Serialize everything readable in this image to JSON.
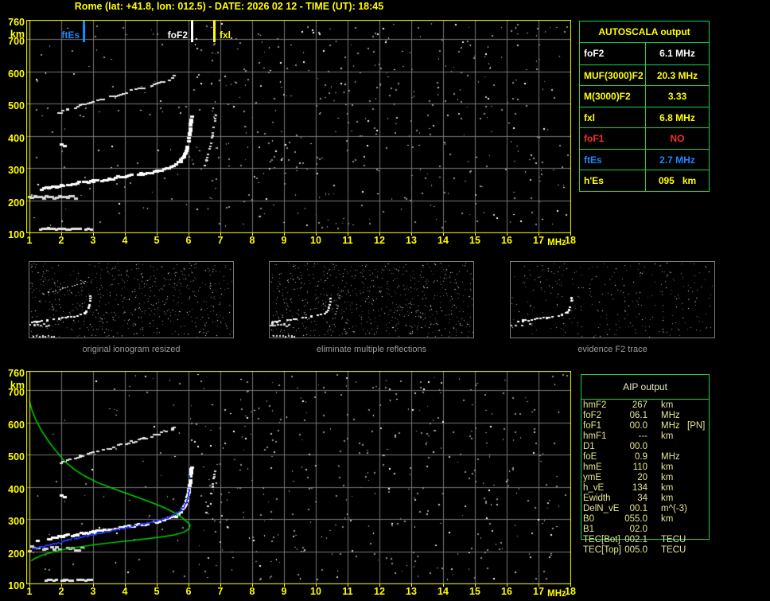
{
  "title": "Rome (lat: +41.8, lon: 012.5) - DATE: 2026 02 12 - TIME (UT): 18:45",
  "colors": {
    "accent_yellow": "#ffff00",
    "grid": "#767676",
    "table_green": "#1ad14f",
    "marker_blue": "#1e86ff",
    "status_red": "#ff2b2b",
    "white": "#ffffff",
    "profile_green": "#00d400",
    "fitted_blue": "#2535ff",
    "noise1": "#909090",
    "noise2": "#c8c8c8",
    "caption_gray": "#9c9c9c",
    "aip_text": "#e6e693"
  },
  "autoscala": {
    "title": "AUTOSCALA output",
    "rows": [
      {
        "label": "foF2",
        "value": "6.1 MHz",
        "color": "#ffffff"
      },
      {
        "label": "MUF(3000)F2",
        "value": "20.3 MHz",
        "color": "#ffff00"
      },
      {
        "label": "M(3000)F2",
        "value": "3.33",
        "color": "#ffff00"
      },
      {
        "label": "fxl",
        "value": "6.8 MHz",
        "color": "#ffff00"
      },
      {
        "label": "foF1",
        "value": "NO",
        "color": "#ff2b2b"
      },
      {
        "label": "ftEs",
        "value": "2.7 MHz",
        "color": "#1e86ff"
      },
      {
        "label": "h'Es",
        "value": "095   km",
        "color": "#ffff00"
      }
    ]
  },
  "aip": {
    "title": "AIP output",
    "rows": [
      {
        "label": "hmF2",
        "value": "267",
        "unit": "km",
        "extra": ""
      },
      {
        "label": "foF2",
        "value": "06.1",
        "unit": "MHz",
        "extra": ""
      },
      {
        "label": "foF1",
        "value": "00.0",
        "unit": "MHz",
        "extra": "[PN]"
      },
      {
        "label": "hmF1",
        "value": "---",
        "unit": "km",
        "extra": ""
      },
      {
        "label": "D1",
        "value": "00.0",
        "unit": "",
        "extra": ""
      },
      {
        "label": "foE",
        "value": "0.9",
        "unit": "MHz",
        "extra": ""
      },
      {
        "label": "hmE",
        "value": "110",
        "unit": "km",
        "extra": ""
      },
      {
        "label": "ymE",
        "value": "20",
        "unit": "km",
        "extra": ""
      },
      {
        "label": "h_vE",
        "value": "134",
        "unit": "km",
        "extra": ""
      },
      {
        "label": "Ewidth",
        "value": "34",
        "unit": "km",
        "extra": ""
      },
      {
        "label": "DelN_vE",
        "value": "00.1",
        "unit": "m^(-3)",
        "extra": ""
      },
      {
        "label": "B0",
        "value": "055.0",
        "unit": "km",
        "extra": ""
      },
      {
        "label": "B1",
        "value": "02.0",
        "unit": "",
        "extra": ""
      },
      {
        "label": "TEC[Bot]",
        "value": "002.1",
        "unit": "TECU",
        "extra": ""
      },
      {
        "label": "TEC[Top]",
        "value": "005.0",
        "unit": "TECU",
        "extra": ""
      }
    ]
  },
  "thumbnails": [
    {
      "caption": "original ionogram resized"
    },
    {
      "caption": "eliminate multiple reflections"
    },
    {
      "caption": "evidence F2 trace"
    }
  ],
  "axes": {
    "x_unit": "MHz",
    "y_unit": "km",
    "x_ticks": [
      1,
      2,
      3,
      4,
      5,
      6,
      7,
      8,
      9,
      10,
      11,
      12,
      13,
      14,
      15,
      16,
      17,
      18
    ],
    "y_ticks": [
      760,
      700,
      600,
      500,
      400,
      300,
      200,
      100
    ]
  },
  "chart_data": {
    "type": "scatter",
    "subtype": "ionogram",
    "xlabel": "frequency (MHz)",
    "ylabel": "virtual height (km)",
    "xlim": [
      1,
      18
    ],
    "ylim": [
      100,
      760
    ],
    "grid": true,
    "markers": [
      {
        "label": "ftEs",
        "mhz": 2.7,
        "color": "#1e86ff",
        "side": "left"
      },
      {
        "label": "foF2",
        "mhz": 6.1,
        "color": "#ffffff",
        "side": "left"
      },
      {
        "label": "fxl",
        "mhz": 6.8,
        "color": "#ffff00",
        "side": "right"
      }
    ],
    "traces": {
      "f2_main": {
        "style": {
          "mode": "speckle",
          "color": "#ffffff",
          "size": [
            5,
            3
          ],
          "step": 2.6,
          "gap": 0.1,
          "jitter": 1.3
        },
        "points": [
          [
            1.25,
            232
          ],
          [
            1.6,
            238
          ],
          [
            2.0,
            245
          ],
          [
            2.5,
            252
          ],
          [
            3.0,
            259
          ],
          [
            3.5,
            266
          ],
          [
            4.0,
            274
          ],
          [
            4.5,
            282
          ],
          [
            5.0,
            291
          ],
          [
            5.3,
            299
          ],
          [
            5.6,
            310
          ],
          [
            5.75,
            322
          ],
          [
            5.85,
            336
          ],
          [
            5.95,
            360
          ],
          [
            6.0,
            385
          ],
          [
            6.05,
            415
          ],
          [
            6.08,
            445
          ],
          [
            6.1,
            460
          ]
        ]
      },
      "f2_hop2": {
        "style": {
          "mode": "speckle",
          "color": "#e8e8e8",
          "size": [
            4,
            2
          ],
          "step": 3,
          "gap": 0.32,
          "jitter": 1.2
        },
        "points": [
          [
            1.85,
            468
          ],
          [
            2.2,
            482
          ],
          [
            2.6,
            494
          ],
          [
            3.0,
            506
          ],
          [
            3.4,
            517
          ],
          [
            3.8,
            528
          ],
          [
            4.2,
            539
          ],
          [
            4.6,
            550
          ],
          [
            5.0,
            561
          ],
          [
            5.3,
            571
          ],
          [
            5.5,
            580
          ],
          [
            5.62,
            590
          ]
        ]
      },
      "x_cusp": {
        "style": {
          "mode": "speckle",
          "color": "#e0e0e0",
          "size": [
            3,
            2
          ],
          "step": 3,
          "gap": 0.5,
          "jitter": 1.0
        },
        "points": [
          [
            6.5,
            308
          ],
          [
            6.56,
            322
          ],
          [
            6.62,
            340
          ],
          [
            6.67,
            358
          ],
          [
            6.71,
            378
          ],
          [
            6.75,
            400
          ],
          [
            6.79,
            424
          ],
          [
            6.83,
            448
          ],
          [
            6.86,
            465
          ]
        ]
      },
      "es_patches": {
        "style": {
          "mode": "speckle",
          "color": "#d8d8d8",
          "size": [
            5,
            3
          ],
          "step": 3,
          "gap": 0.22,
          "jitter": 2.4
        },
        "points": [
          [
            1.0,
            207
          ],
          [
            1.2,
            210
          ],
          [
            1.45,
            206
          ],
          [
            1.7,
            211
          ],
          [
            1.95,
            207
          ],
          [
            2.2,
            211
          ],
          [
            2.45,
            207
          ],
          [
            2.65,
            209
          ]
        ]
      },
      "es_low": {
        "style": {
          "mode": "speckle",
          "color": "#e8e8e8",
          "size": [
            4,
            3
          ],
          "step": 3,
          "gap": 0.28,
          "jitter": 0.7
        },
        "points": [
          [
            1.35,
            110
          ],
          [
            1.6,
            111
          ],
          [
            1.85,
            110
          ],
          [
            2.1,
            111
          ],
          [
            2.35,
            110
          ],
          [
            2.6,
            111
          ],
          [
            2.85,
            110
          ],
          [
            3.05,
            110
          ]
        ]
      },
      "spots": {
        "style": {
          "mode": "points",
          "color": "#ffffff",
          "size": [
            5,
            3
          ]
        },
        "points": [
          [
            2.0,
            372
          ],
          [
            2.12,
            369
          ]
        ]
      },
      "profile_green": {
        "style": {
          "mode": "line",
          "color": "#00d400",
          "size": [
            1.5,
            0
          ]
        },
        "points": [
          [
            1.0,
            667
          ],
          [
            1.08,
            638
          ],
          [
            1.2,
            608
          ],
          [
            1.38,
            575
          ],
          [
            1.6,
            542
          ],
          [
            1.85,
            510
          ],
          [
            2.1,
            480
          ],
          [
            2.4,
            455
          ],
          [
            2.75,
            433
          ],
          [
            3.15,
            413
          ],
          [
            3.6,
            396
          ],
          [
            4.05,
            380
          ],
          [
            4.5,
            364
          ],
          [
            4.9,
            349
          ],
          [
            5.25,
            335
          ],
          [
            5.55,
            320
          ],
          [
            5.78,
            306
          ],
          [
            5.95,
            292
          ],
          [
            6.05,
            281
          ],
          [
            6.02,
            270
          ],
          [
            5.85,
            259
          ],
          [
            5.55,
            251
          ],
          [
            5.1,
            244
          ],
          [
            4.6,
            238
          ],
          [
            4.1,
            232
          ],
          [
            3.6,
            227
          ],
          [
            3.1,
            221
          ],
          [
            2.6,
            214
          ],
          [
            2.1,
            206
          ],
          [
            1.7,
            197
          ],
          [
            1.4,
            188
          ],
          [
            1.18,
            178
          ],
          [
            1.05,
            170
          ]
        ]
      },
      "fitted_blue": {
        "style": {
          "mode": "speckle",
          "color": "#2535ff",
          "size": [
            2,
            2
          ],
          "step": 1.7,
          "gap": 0.05,
          "jitter": 0.7
        },
        "points": [
          [
            1.1,
            207
          ],
          [
            1.4,
            214
          ],
          [
            1.8,
            224
          ],
          [
            2.2,
            234
          ],
          [
            2.6,
            243
          ],
          [
            3.0,
            252
          ],
          [
            3.4,
            260
          ],
          [
            3.8,
            268
          ],
          [
            4.2,
            276
          ],
          [
            4.6,
            285
          ],
          [
            5.0,
            294
          ],
          [
            5.3,
            303
          ],
          [
            5.55,
            313
          ],
          [
            5.75,
            326
          ],
          [
            5.87,
            340
          ],
          [
            5.94,
            355
          ],
          [
            5.99,
            372
          ],
          [
            6.02,
            390
          ]
        ]
      },
      "blue_dots": {
        "style": {
          "mode": "points",
          "color": "#2535ff",
          "size": [
            3,
            3
          ]
        },
        "points": [
          [
            6.0,
            432
          ]
        ]
      }
    },
    "top_chart": {
      "traces": [
        "f2_main",
        "f2_hop2",
        "x_cusp",
        "es_patches",
        "es_low",
        "spots"
      ],
      "has_markers": true,
      "noise": {
        "count": 540,
        "seed": 7
      }
    },
    "bottom_chart": {
      "traces": [
        "f2_main",
        "f2_hop2",
        "x_cusp",
        "es_patches",
        "es_low",
        "spots",
        "profile_green",
        "fitted_blue",
        "blue_dots"
      ],
      "has_markers": false,
      "noise": {
        "count": 500,
        "seed": 13
      }
    },
    "thumb_charts": [
      {
        "traces": [
          "f2_main",
          "f2_hop2",
          "es_patches",
          "es_low"
        ],
        "gap_boost": 0.05,
        "noise": {
          "count": 620,
          "seed": 21
        }
      },
      {
        "traces": [
          "f2_main",
          "es_patches",
          "es_low",
          "x_cusp"
        ],
        "gap_boost": 0.1,
        "noise": {
          "count": 720,
          "seed": 22
        }
      },
      {
        "traces": [
          "f2_main",
          "es_patches"
        ],
        "gap_boost": 0.35,
        "noise": {
          "count": 300,
          "seed": 23
        }
      }
    ]
  }
}
